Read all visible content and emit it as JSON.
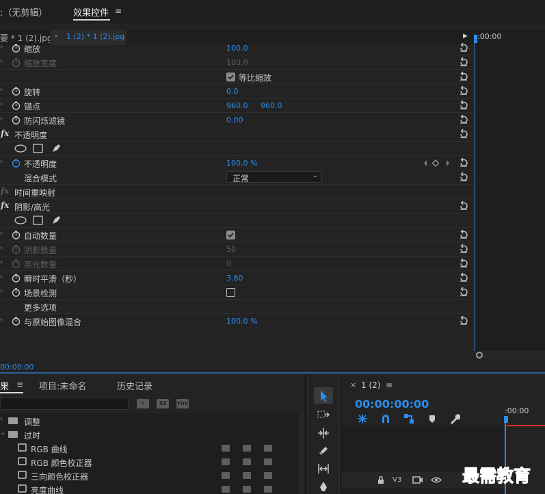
{
  "top_tabs": {
    "noclip": ":（无剪辑）",
    "effects": "效果控件",
    "menu": "≡"
  },
  "clip_bar": {
    "master": "要 * 1 (2).jpg",
    "arrow": "⌄",
    "sequence": "1 (2) * 1 (2).jpg",
    "play": "▶",
    "ruler_time": ":00:00"
  },
  "properties": [
    {
      "label": "缩放",
      "value": "100.0",
      "dim": false
    },
    {
      "label": "缩放宽度",
      "value": "100.0",
      "dim": true
    },
    {
      "label": "",
      "checkbox_label": "等比缩放"
    },
    {
      "label": "旋转",
      "value": "0.0"
    },
    {
      "label": "锚点",
      "value": "960.0",
      "value2": "960.0"
    },
    {
      "label": "防闪烁滤镜",
      "value": "0.00"
    },
    {
      "label": "不透明度",
      "fx": "fx"
    },
    {
      "label": "",
      "masks": true
    },
    {
      "label": "不透明度",
      "value": "100.0 %"
    },
    {
      "label": "混合模式",
      "dropdown": "正常"
    },
    {
      "label": "时间重映射",
      "fx": "fx",
      "dim_fx": true
    },
    {
      "label": "阴影/高光",
      "fx": "fx"
    },
    {
      "label": "",
      "masks": true
    },
    {
      "label": "自动数量"
    },
    {
      "label": "阴影数量",
      "value": "50",
      "dim": true
    },
    {
      "label": "高光数量",
      "value": "0",
      "dim": true
    },
    {
      "label": "瞬时平滑（秒）",
      "value": "3.80"
    },
    {
      "label": "场景检测"
    },
    {
      "label": "更多选项"
    },
    {
      "label": "与原始图像混合",
      "value": "100.0 %"
    }
  ],
  "bottom_timecode": "00:00:00",
  "effects_panel": {
    "tab_effects": "果",
    "tab_menu": "≡",
    "tab_project": "项目:未命名",
    "tab_history": "历史记录",
    "badges": [
      "⚡",
      "32",
      "YUV"
    ],
    "items": [
      {
        "name": "调整",
        "type": "folder"
      },
      {
        "name": "过时",
        "type": "folder"
      },
      {
        "name": "RGB 曲线",
        "type": "effect"
      },
      {
        "name": "RGB 颜色校正器",
        "type": "effect"
      },
      {
        "name": "三向颜色校正器",
        "type": "effect"
      },
      {
        "name": "亮度曲线",
        "type": "effect"
      }
    ]
  },
  "sequence_panel": {
    "close": "×",
    "name": "1 (2)",
    "menu": "≡",
    "timecode": "00:00:00:00",
    "ruler_time": ":00:00",
    "track_label": "V3"
  },
  "watermark": "最需教育",
  "colors": {
    "accent": "#2d8ceb",
    "panel": "#232323",
    "text": "#c8c8c8",
    "playhead_red": "#d8302e"
  }
}
